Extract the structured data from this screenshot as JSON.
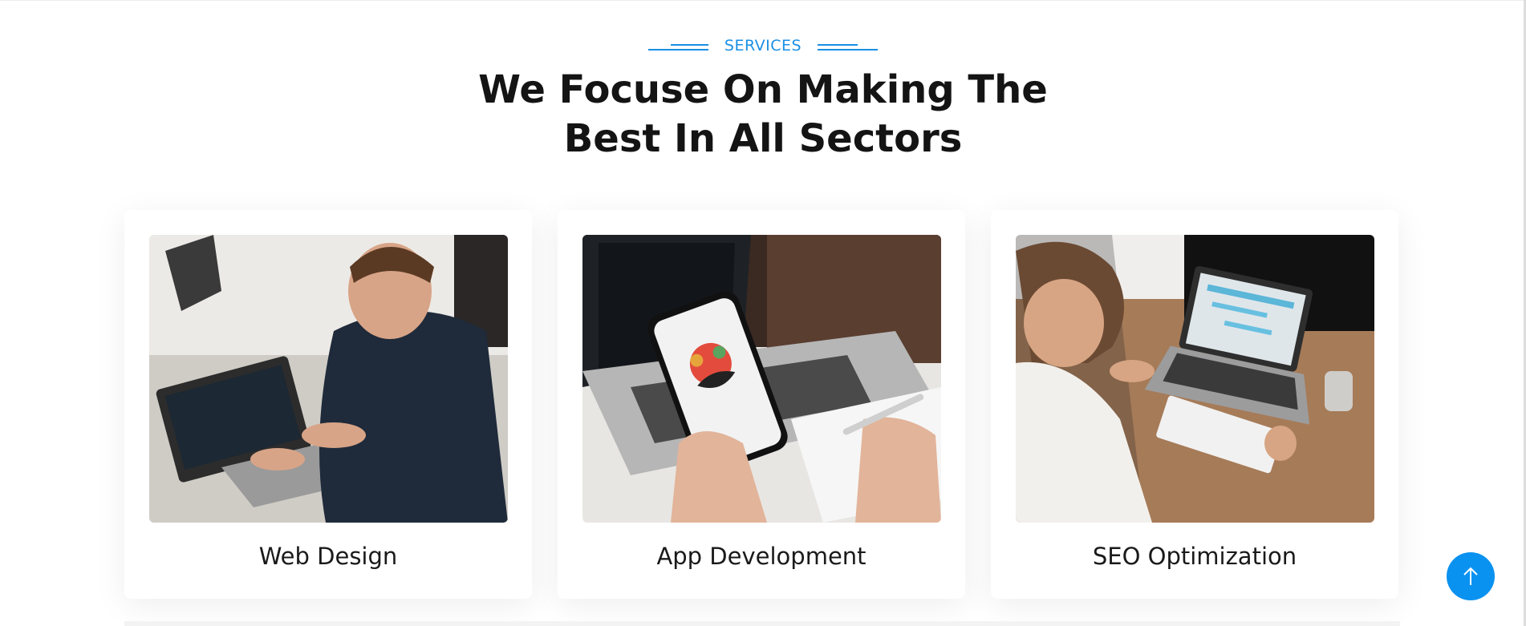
{
  "section": {
    "eyebrow": "SERVICES",
    "title_line1": "We Focuse On Making The",
    "title_line2": "Best In All Sectors"
  },
  "services": [
    {
      "title": "Web Design",
      "image": "person-typing-on-laptop"
    },
    {
      "title": "App Development",
      "image": "hand-holding-smartphone"
    },
    {
      "title": "SEO Optimization",
      "image": "person-at-desk-with-laptop"
    }
  ],
  "scroll_top": {
    "icon": "arrow-up-icon"
  },
  "colors": {
    "accent": "#1a8fe3",
    "button": "#0a92f0",
    "heading": "#141414"
  }
}
